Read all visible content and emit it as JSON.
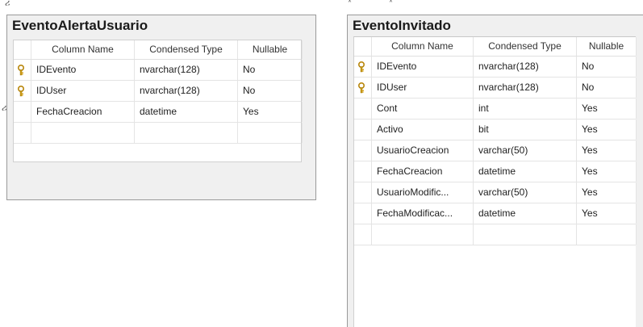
{
  "diagram": {
    "tables": [
      {
        "title": "EventoAlertaUsuario",
        "columns_header": [
          "Column Name",
          "Condensed Type",
          "Nullable"
        ],
        "rows": [
          {
            "key": true,
            "name": "IDEvento",
            "type": "nvarchar(128)",
            "nullable": "No"
          },
          {
            "key": true,
            "name": "IDUser",
            "type": "nvarchar(128)",
            "nullable": "No"
          },
          {
            "key": false,
            "name": "FechaCreacion",
            "type": "datetime",
            "nullable": "Yes"
          },
          {
            "key": false,
            "name": "",
            "type": "",
            "nullable": ""
          }
        ]
      },
      {
        "title": "EventoInvitado",
        "columns_header": [
          "Column Name",
          "Condensed Type",
          "Nullable"
        ],
        "rows": [
          {
            "key": true,
            "name": "IDEvento",
            "type": "nvarchar(128)",
            "nullable": "No"
          },
          {
            "key": true,
            "name": "IDUser",
            "type": "nvarchar(128)",
            "nullable": "No"
          },
          {
            "key": false,
            "name": "Cont",
            "type": "int",
            "nullable": "Yes"
          },
          {
            "key": false,
            "name": "Activo",
            "type": "bit",
            "nullable": "Yes"
          },
          {
            "key": false,
            "name": "UsuarioCreacion",
            "type": "varchar(50)",
            "nullable": "Yes"
          },
          {
            "key": false,
            "name": "FechaCreacion",
            "type": "datetime",
            "nullable": "Yes"
          },
          {
            "key": false,
            "name": "UsuarioModific...",
            "type": "varchar(50)",
            "nullable": "Yes"
          },
          {
            "key": false,
            "name": "FechaModificac...",
            "type": "datetime",
            "nullable": "Yes"
          },
          {
            "key": false,
            "name": "",
            "type": "",
            "nullable": ""
          }
        ]
      }
    ],
    "colors": {
      "frame_border": "#9a9a9a",
      "frame_bg": "#f0f0f0",
      "grid_bg": "#ffffff",
      "key_icon": "#d4a017"
    },
    "icons": [
      "primary-key-icon",
      "resize-handle-icon"
    ]
  }
}
